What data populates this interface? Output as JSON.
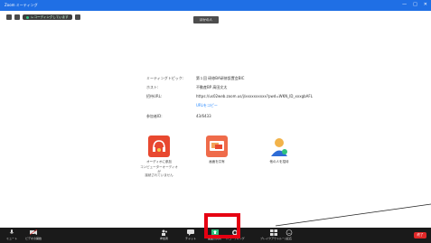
{
  "window": {
    "title": "Zoom ミーティング",
    "controls": [
      "—",
      "□",
      "✕"
    ]
  },
  "topstrip": {
    "recording_label": "レコーディングしています"
  },
  "speaker_tag": "ほかの人",
  "meeting_info": {
    "topic_label": "ミーティングトピック:",
    "topic_value": "第１回 研修BA研修設置会BIC",
    "host_label": "ホスト:",
    "host_value": "不動産BP 高田文太",
    "invite_label": "招待URL:",
    "invite_value": "https://us02web.zoom.us/j/xxxxxxxxxx?pwd=WKN_ID_xxxgbAFL",
    "copy_link": "URLをコピー",
    "participant_label": "参加者ID:",
    "participant_value": "43/6433"
  },
  "tiles": [
    {
      "name": "audio",
      "label": "オーディオに参加",
      "sub": "コンピューターオーディオが\n接続されていません"
    },
    {
      "name": "screen-share",
      "label": "画面を共有",
      "sub": ""
    },
    {
      "name": "invite",
      "label": "他の人を招待",
      "sub": ""
    }
  ],
  "toolbar": {
    "left": [
      {
        "name": "mute",
        "label": "ミュート"
      },
      {
        "name": "video-start",
        "label": "ビデオの開始"
      }
    ],
    "center": [
      {
        "name": "participants",
        "label": "参加者",
        "badge": "1"
      },
      {
        "name": "chat",
        "label": "チャット"
      },
      {
        "name": "share-screen",
        "label": "画面の共有"
      },
      {
        "name": "record",
        "label": "レコーディング"
      },
      {
        "name": "breakout",
        "label": "ブレイクアウトルーム"
      },
      {
        "name": "reaction",
        "label": "反応"
      }
    ],
    "end_label": "終了"
  },
  "colors": {
    "titlebar": "#1f6fe5",
    "highlight": "#e60012",
    "end_button": "#e02828"
  }
}
